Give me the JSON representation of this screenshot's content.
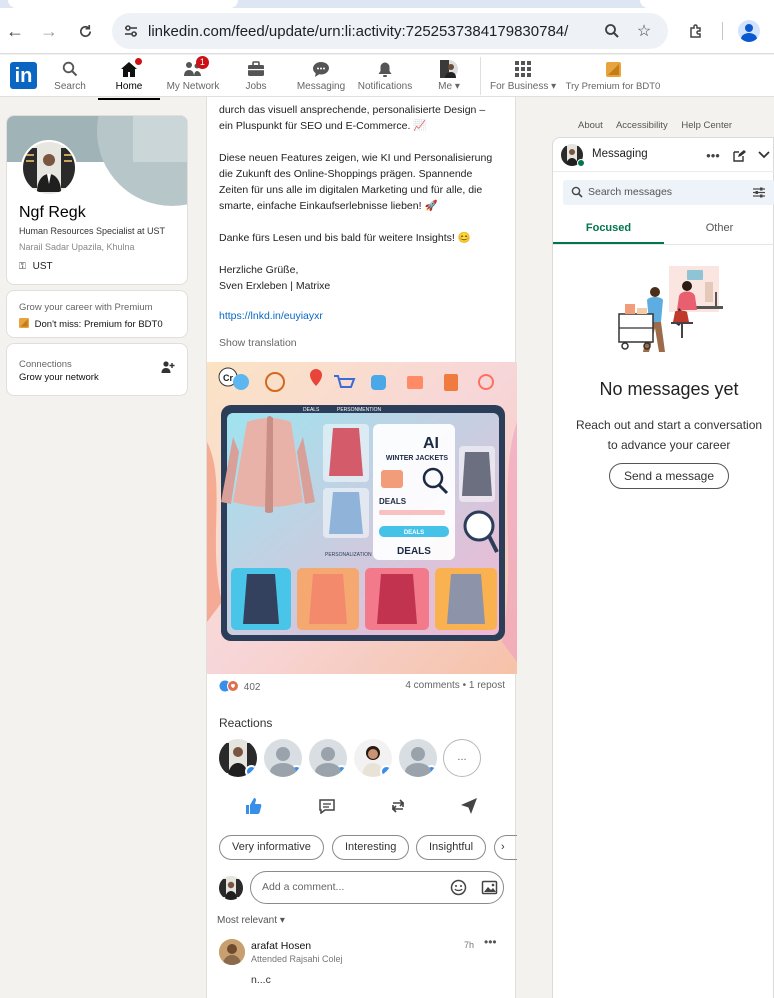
{
  "browser": {
    "url": "linkedin.com/feed/update/urn:li:activity:7252537384179830784/"
  },
  "nav": {
    "logo": "in",
    "items": [
      {
        "label": "Search"
      },
      {
        "label": "Home",
        "active": true,
        "badge": ""
      },
      {
        "label": "My Network",
        "badge": "1"
      },
      {
        "label": "Jobs"
      },
      {
        "label": "Messaging"
      },
      {
        "label": "Notifications"
      },
      {
        "label": "Me"
      },
      {
        "label": "For Business"
      },
      {
        "label": "Try Premium for BDT0"
      }
    ]
  },
  "profile": {
    "name": "Ngf Regk",
    "headline": "Human Resources Specialist at UST",
    "location": "Narail Sadar Upazila, Khulna",
    "company": "UST"
  },
  "premium": {
    "title": "Grow your career with Premium",
    "link": "Don't miss: Premium for BDT0"
  },
  "connections": {
    "title": "Connections",
    "subtitle": "Grow your network"
  },
  "post": {
    "lines": [
      "durch das visuell ansprechende, personalisierte Design –",
      "ein Pluspunkt für SEO und E-Commerce. 📈",
      "Diese neuen Features zeigen, wie KI und Personalisierung",
      "die Zukunft des Online-Shoppings prägen. Spannende",
      "Zeiten für uns alle im digitalen Marketing und für alle, die",
      "smarte, einfache Einkaufserlebnisse lieben! 🚀",
      "Danke fürs Lesen und bis bald für weitere Insights! 😊",
      "Herzliche Grüße,",
      "Sven Erxleben | Matrixe"
    ],
    "link": "https://lnkd.in/euyiayxr",
    "show_translation": "Show translation",
    "image": {
      "header_left": "DEALS",
      "header_right": "PERSONMENTION",
      "ai": "AI",
      "title": "WINTER JACKETS",
      "deals_label": "DEALS",
      "deals_button": "DEALS",
      "deals_banner": "DEALS",
      "personalization": "PERSONALIZATION"
    },
    "reaction_count": "402",
    "comments_reposts": "4 comments • 1 repost",
    "reactions_heading": "Reactions",
    "more": "...",
    "chips": [
      "Very informative",
      "Interesting",
      "Insightful"
    ],
    "comment_placeholder": "Add a comment...",
    "sort": "Most relevant"
  },
  "comment": {
    "author": "arafat Hosen",
    "subtitle": "Attended Rajsahi Colej",
    "time": "7h",
    "text": "n...c"
  },
  "footer_links": [
    "About",
    "Accessibility",
    "Help Center"
  ],
  "messaging": {
    "title": "Messaging",
    "search_placeholder": "Search messages",
    "tabs": [
      "Focused",
      "Other"
    ],
    "empty_title": "No messages yet",
    "empty_line1": "Reach out and start a conversation",
    "empty_line2": "to advance your career",
    "send_button": "Send a message"
  },
  "colors": {
    "brand": "#0a66c2",
    "focused_tab": "#01754f",
    "badge": "#cc1016"
  }
}
